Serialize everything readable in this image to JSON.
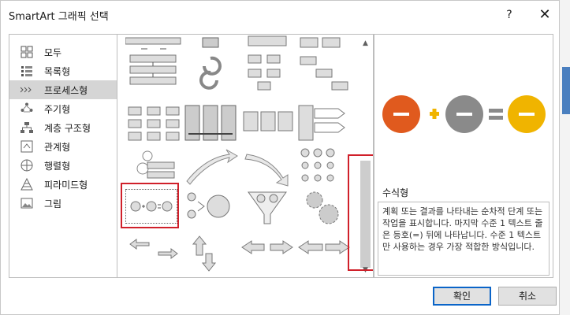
{
  "dialog": {
    "title": "SmartArt 그래픽 선택",
    "help_label": "?",
    "close_label": "✕"
  },
  "categories": [
    {
      "label": "모두",
      "icon": "all-icon"
    },
    {
      "label": "목록형",
      "icon": "list-icon"
    },
    {
      "label": "프로세스형",
      "icon": "process-icon",
      "selected": true
    },
    {
      "label": "주기형",
      "icon": "cycle-icon"
    },
    {
      "label": "계층 구조형",
      "icon": "hierarchy-icon"
    },
    {
      "label": "관계형",
      "icon": "relationship-icon"
    },
    {
      "label": "행렬형",
      "icon": "matrix-icon"
    },
    {
      "label": "피라미드형",
      "icon": "pyramid-icon"
    },
    {
      "label": "그림",
      "icon": "picture-icon"
    }
  ],
  "preview": {
    "name": "수식형",
    "description": "계획 또는 결과를 나타내는 순차적 단계 또는 작업을 표시합니다. 마지막 수준 1 텍스트 줄은 등호(=) 뒤에 나타납니다. 수준 1 텍스트만 사용하는 경우 가장 적합한 방식입니다.",
    "colors": {
      "orange": "#e05a1e",
      "gray": "#8a8a8a",
      "gold": "#f0b400"
    }
  },
  "buttons": {
    "ok_label": "확인",
    "cancel_label": "취소"
  },
  "colors": {
    "highlight": "#d0202a",
    "accent": "#0a64c8"
  }
}
